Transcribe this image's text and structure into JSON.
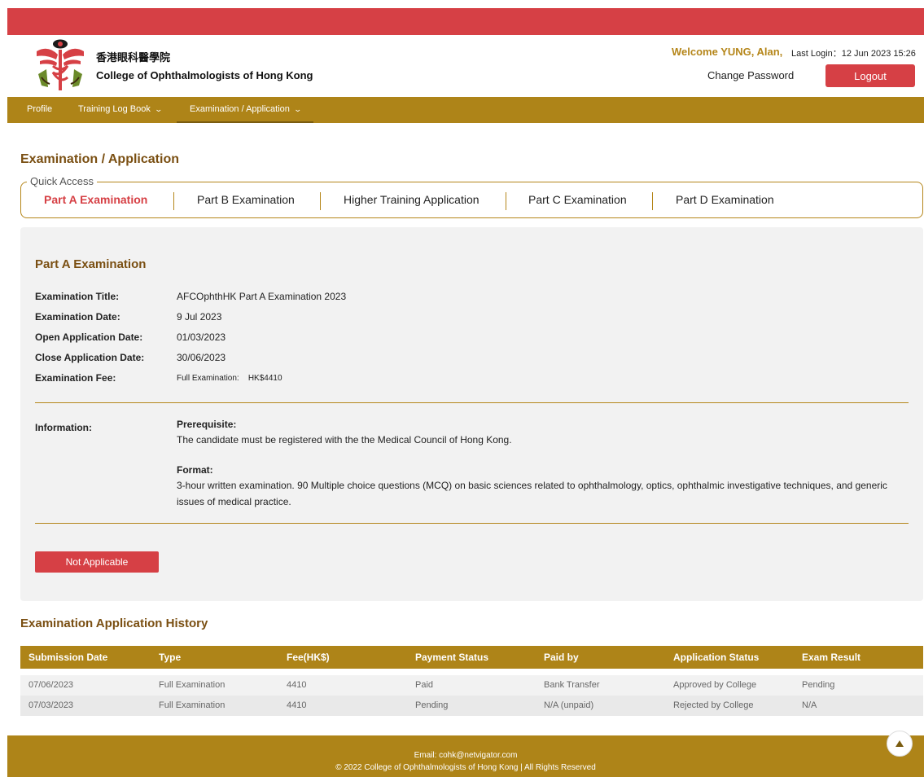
{
  "colors": {
    "brand_red": "#d64045",
    "brand_gold": "#ae8418",
    "heading_brown": "#7a4f12"
  },
  "header": {
    "brand_zh": "香港眼科醫學院",
    "brand_en": "College of Ophthalmologists of Hong Kong",
    "welcome": "Welcome YUNG, Alan,",
    "last_login": "Last Login：12 Jun 2023 15:26",
    "change_password": "Change Password",
    "logout": "Logout",
    "logo_icon": "college-crest-icon"
  },
  "nav": {
    "items": [
      {
        "label": "Profile",
        "has_dropdown": false
      },
      {
        "label": "Training Log Book",
        "has_dropdown": true
      },
      {
        "label": "Examination / Application",
        "has_dropdown": true,
        "active": true
      }
    ]
  },
  "page_title": "Examination / Application",
  "quick_access": {
    "legend": "Quick Access",
    "tabs": [
      {
        "label": "Part A Examination",
        "active": true
      },
      {
        "label": "Part B Examination"
      },
      {
        "label": "Higher Training Application"
      },
      {
        "label": "Part C Examination"
      },
      {
        "label": "Part D Examination"
      }
    ]
  },
  "exam": {
    "heading": "Part A Examination",
    "fields": [
      {
        "label": "Examination Title:",
        "value": "AFCOphthHK Part A Examination 2023"
      },
      {
        "label": "Examination Date:",
        "value": "9 Jul 2023"
      },
      {
        "label": "Open Application Date:",
        "value": "01/03/2023"
      },
      {
        "label": "Close Application Date:",
        "value": "30/06/2023"
      },
      {
        "label": "Examination Fee:",
        "value": "Full Examination:    HK$4410"
      }
    ],
    "info_label": "Information:",
    "prereq_heading": "Prerequisite:",
    "prereq_text": "The candidate must be registered with the the Medical Council of Hong Kong.",
    "format_heading": "Format:",
    "format_text": "3-hour written examination. 90 Multiple choice questions (MCQ) on basic sciences related to ophthalmology, optics, ophthalmic investigative techniques, and generic issues of medical practice.",
    "button": "Not Applicable"
  },
  "history": {
    "title": "Examination Application History",
    "columns": [
      "Submission Date",
      "Type",
      "Fee(HK$)",
      "Payment Status",
      "Paid by",
      "Application Status",
      "Exam Result"
    ],
    "rows": [
      [
        "07/06/2023",
        "Full Examination",
        "4410",
        "Paid",
        "Bank Transfer",
        "Approved by College",
        "Pending"
      ],
      [
        "07/03/2023",
        "Full Examination",
        "4410",
        "Pending",
        "N/A (unpaid)",
        "Rejected by College",
        "N/A"
      ]
    ]
  },
  "footer": {
    "email": "Email: cohk@netvigator.com",
    "copyright": "© 2022 College of Ophthalmologists of Hong Kong | All Rights Reserved",
    "to_top_icon": "arrow-up-icon"
  }
}
